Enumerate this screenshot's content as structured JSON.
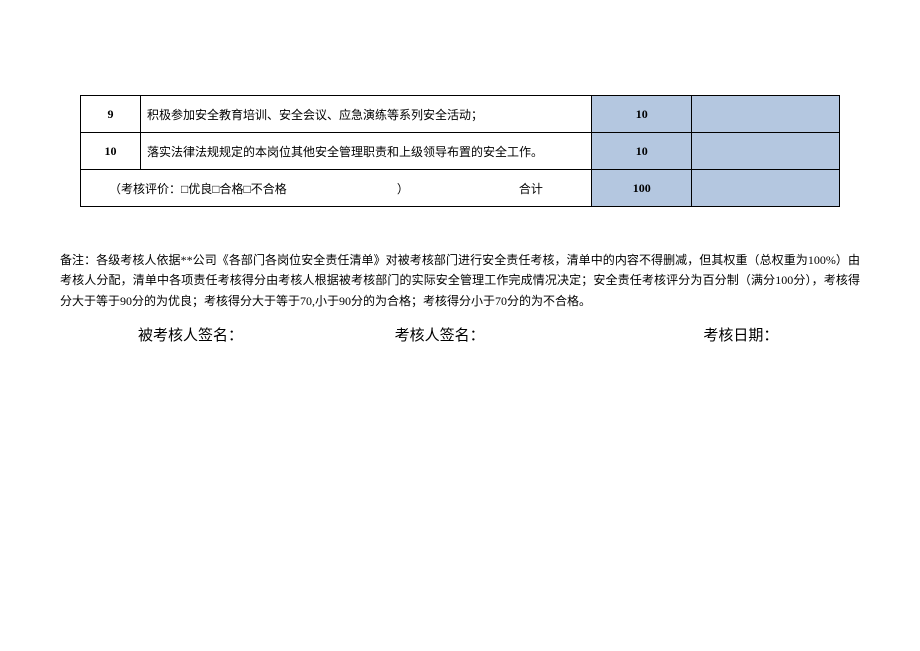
{
  "table": {
    "rows": [
      {
        "num": "9",
        "desc": "积极参加安全教育培训、安全会议、应急演练等系列安全活动；",
        "weight": "10",
        "score": ""
      },
      {
        "num": "10",
        "desc": "落实法律法规规定的本岗位其他安全管理职责和上级领导布置的安全工作。",
        "weight": "10",
        "score": ""
      }
    ],
    "summary": {
      "eval_label_prefix": "（考核评价：",
      "opt1": "优良",
      "opt2": "合格",
      "opt3": "不合格",
      "eval_label_suffix": "）",
      "total_label": "合计",
      "total_value": "100",
      "total_score": ""
    }
  },
  "note": "备注：各级考核人依据**公司《各部门各岗位安全责任清单》对被考核部门进行安全责任考核，清单中的内容不得删减，但其权重（总权重为100%）由考核人分配，清单中各项责任考核得分由考核人根据被考核部门的实际安全管理工作完成情况决定；安全责任考核评分为百分制（满分100分），考核得分大于等于90分的为优良；考核得分大于等于70,小于90分的为合格；考核得分小于70分的为不合格。",
  "signatures": {
    "examinee": "被考核人签名：",
    "examiner": "考核人签名：",
    "date": "考核日期："
  },
  "checkbox_glyph": "□"
}
